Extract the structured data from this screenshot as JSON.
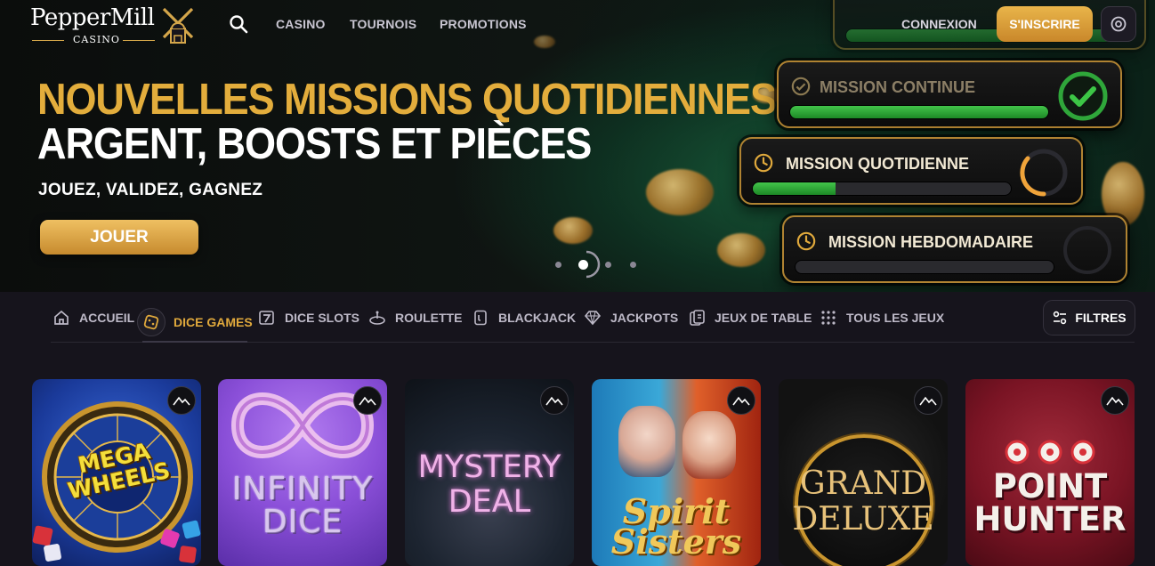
{
  "header": {
    "logo": {
      "wordmark": "PepperMill",
      "subtitle": "CASINO"
    },
    "nav": [
      "CASINO",
      "TOURNOIS",
      "PROMOTIONS"
    ],
    "login_label": "CONNEXION",
    "signup_label": "S'INSCRIRE"
  },
  "hero": {
    "title_line1": "NOUVELLES MISSIONS QUOTIDIENNES",
    "title_line2": "ARGENT, BOOSTS ET PIÈCES",
    "subtitle": "JOUEZ, VALIDEZ, GAGNEZ",
    "cta_label": "JOUER",
    "missions": [
      {
        "label": "MISSION CONTINUE",
        "progress": 1.0,
        "state": "complete"
      },
      {
        "label": "MISSION QUOTIDIENNE",
        "progress": 0.32,
        "state": "in-progress"
      },
      {
        "label": "MISSION HEBDOMADAIRE",
        "progress": 0.0,
        "state": "not-started"
      }
    ],
    "carousel": {
      "slides": 4,
      "active_index": 1
    }
  },
  "categories": {
    "items": [
      {
        "label": "ACCUEIL",
        "icon": "home-icon",
        "active": false
      },
      {
        "label": "DICE GAMES",
        "icon": "dice-icon",
        "active": true
      },
      {
        "label": "DICE SLOTS",
        "icon": "slot-seven-icon",
        "active": false
      },
      {
        "label": "ROULETTE",
        "icon": "roulette-icon",
        "active": false
      },
      {
        "label": "BLACKJACK",
        "icon": "cards-icon",
        "active": false
      },
      {
        "label": "JACKPOTS",
        "icon": "diamond-icon",
        "active": false
      },
      {
        "label": "JEUX DE TABLE",
        "icon": "table-cards-icon",
        "active": false
      },
      {
        "label": "TOUS LES JEUX",
        "icon": "grid-dots-icon",
        "active": false
      }
    ],
    "filters_label": "FILTRES"
  },
  "games": [
    {
      "title": "MEGA\nWHEELS",
      "theme": "#1a3a9a"
    },
    {
      "title": "INFINITY\nDICE",
      "theme": "#8a4fd8"
    },
    {
      "title": "MYSTERY\nDEAL",
      "theme": "#1c2430"
    },
    {
      "title": "Spirit\nSisters",
      "theme": "#2a8ab0"
    },
    {
      "title": "GRAND\nDELUXE",
      "theme": "#121212"
    },
    {
      "title": "POINT\nHUNTER",
      "theme": "#7a1424"
    }
  ],
  "colors": {
    "accent_gold": "#e0a93c",
    "background": "#16141c",
    "progress_green": "#42c44a"
  }
}
